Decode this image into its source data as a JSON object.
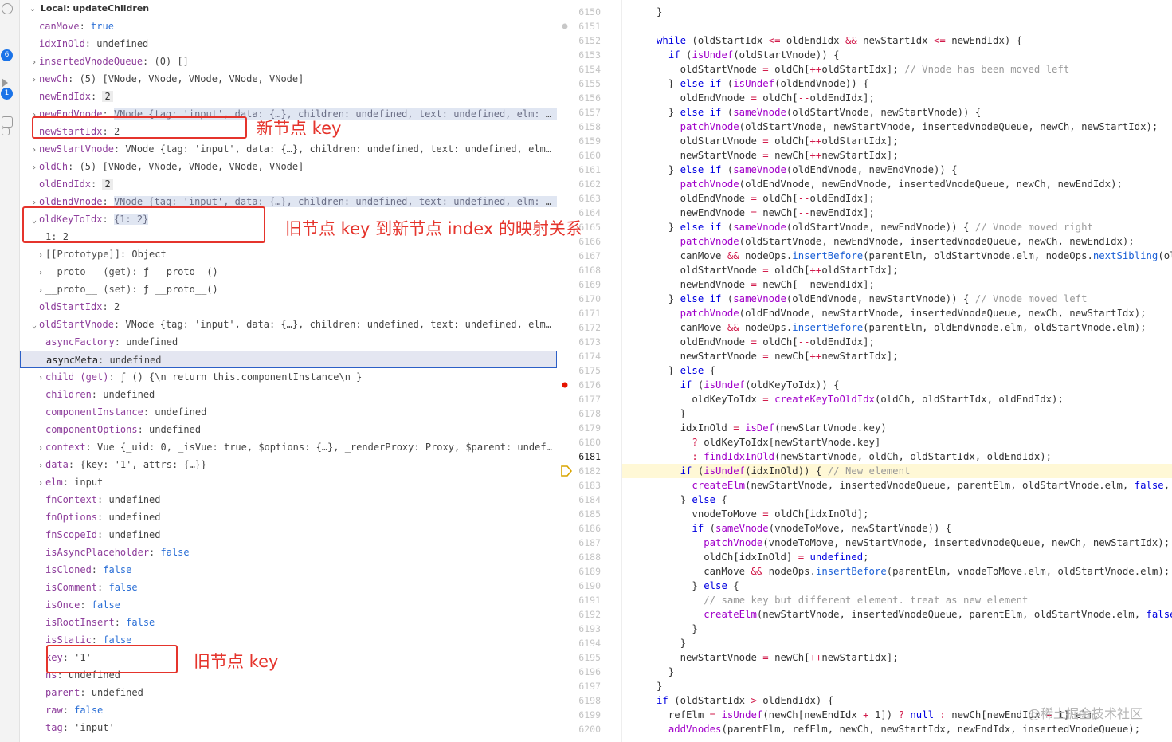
{
  "variables": {
    "scope_header": "Local: updateChildren",
    "rows": [
      {
        "indent": 0,
        "chev": "",
        "key": "canMove",
        "val": "true",
        "vt": "kw"
      },
      {
        "indent": 0,
        "chev": "",
        "key": "idxInOld",
        "val": "undefined",
        "vt": ""
      },
      {
        "indent": 0,
        "chev": "›",
        "key": "insertedVnodeQueue",
        "val": "(0) []",
        "vt": ""
      },
      {
        "indent": 0,
        "chev": "›",
        "key": "newCh",
        "val": "(5) [VNode, VNode, VNode, VNode, VNode]",
        "vt": ""
      },
      {
        "indent": 0,
        "chev": "",
        "key": "newEndIdx",
        "val": "2",
        "vt": "num"
      },
      {
        "indent": 0,
        "chev": "›",
        "key": "newEndVnode",
        "val": "VNode {tag: 'input', data: {…}, children: undefined, text: undefined, elm: undefin…",
        "vt": "hl"
      },
      {
        "indent": 0,
        "chev": "",
        "key": "newStartIdx",
        "val": "2",
        "vt": ""
      },
      {
        "indent": 0,
        "chev": "›",
        "key": "newStartVnode",
        "val": "VNode {tag: 'input', data: {…}, children: undefined, text: undefined, elm: undef…",
        "vt": ""
      },
      {
        "indent": 0,
        "chev": "›",
        "key": "oldCh",
        "val": "(5) [VNode, VNode, VNode, VNode, VNode]",
        "vt": ""
      },
      {
        "indent": 0,
        "chev": "",
        "key": "oldEndIdx",
        "val": "2",
        "vt": "num"
      },
      {
        "indent": 0,
        "chev": "›",
        "key": "oldEndVnode",
        "val": "VNode {tag: 'input', data: {…}, children: undefined, text: undefined, elm: input, …",
        "vt": "hl"
      },
      {
        "indent": 0,
        "chev": "⌄",
        "key": "oldKeyToIdx",
        "val": "{1: 2}",
        "vt": "hl"
      },
      {
        "indent": 1,
        "chev": "",
        "key": "1",
        "val": "2",
        "vt": "",
        "plainkey": true
      },
      {
        "indent": 1,
        "chev": "›",
        "key": "[[Prototype]]",
        "val": "Object",
        "vt": "",
        "plainkey": true
      },
      {
        "indent": 1,
        "chev": "›",
        "key": "__proto__ (get)",
        "val": "ƒ __proto__()",
        "vt": "",
        "plainkey": true
      },
      {
        "indent": 1,
        "chev": "›",
        "key": "__proto__ (set)",
        "val": "ƒ __proto__()",
        "vt": "",
        "plainkey": true
      },
      {
        "indent": 0,
        "chev": "",
        "key": "oldStartIdx",
        "val": "2",
        "vt": ""
      },
      {
        "indent": 0,
        "chev": "⌄",
        "key": "oldStartVnode",
        "val": "VNode {tag: 'input', data: {…}, children: undefined, text: undefined, elm: input…",
        "vt": ""
      },
      {
        "indent": 1,
        "chev": "",
        "key": "asyncFactory",
        "val": "undefined",
        "vt": ""
      },
      {
        "indent": 1,
        "chev": "",
        "key": "asyncMeta",
        "val": "undefined",
        "vt": "",
        "selected": true
      },
      {
        "indent": 1,
        "chev": "›",
        "key": "child (get)",
        "val": "ƒ () {\\n    return this.componentInstance\\n  }",
        "vt": ""
      },
      {
        "indent": 1,
        "chev": "",
        "key": "children",
        "val": "undefined",
        "vt": ""
      },
      {
        "indent": 1,
        "chev": "",
        "key": "componentInstance",
        "val": "undefined",
        "vt": ""
      },
      {
        "indent": 1,
        "chev": "",
        "key": "componentOptions",
        "val": "undefined",
        "vt": ""
      },
      {
        "indent": 1,
        "chev": "›",
        "key": "context",
        "val": "Vue {_uid: 0, _isVue: true, $options: {…}, _renderProxy: Proxy, $parent: undefined, …}",
        "vt": ""
      },
      {
        "indent": 1,
        "chev": "›",
        "key": "data",
        "val": "{key: '1', attrs: {…}}",
        "vt": ""
      },
      {
        "indent": 1,
        "chev": "›",
        "key": "elm",
        "val": "input",
        "vt": ""
      },
      {
        "indent": 1,
        "chev": "",
        "key": "fnContext",
        "val": "undefined",
        "vt": ""
      },
      {
        "indent": 1,
        "chev": "",
        "key": "fnOptions",
        "val": "undefined",
        "vt": ""
      },
      {
        "indent": 1,
        "chev": "",
        "key": "fnScopeId",
        "val": "undefined",
        "vt": ""
      },
      {
        "indent": 1,
        "chev": "",
        "key": "isAsyncPlaceholder",
        "val": "false",
        "vt": "kw"
      },
      {
        "indent": 1,
        "chev": "",
        "key": "isCloned",
        "val": "false",
        "vt": "kw"
      },
      {
        "indent": 1,
        "chev": "",
        "key": "isComment",
        "val": "false",
        "vt": "kw"
      },
      {
        "indent": 1,
        "chev": "",
        "key": "isOnce",
        "val": "false",
        "vt": "kw"
      },
      {
        "indent": 1,
        "chev": "",
        "key": "isRootInsert",
        "val": "false",
        "vt": "kw"
      },
      {
        "indent": 1,
        "chev": "",
        "key": "isStatic",
        "val": "false",
        "vt": "kw"
      },
      {
        "indent": 1,
        "chev": "",
        "key": "key",
        "val": "'1'",
        "vt": ""
      },
      {
        "indent": 1,
        "chev": "",
        "key": "ns",
        "val": "undefined",
        "vt": ""
      },
      {
        "indent": 1,
        "chev": "",
        "key": "parent",
        "val": "undefined",
        "vt": ""
      },
      {
        "indent": 1,
        "chev": "",
        "key": "raw",
        "val": "false",
        "vt": "kw"
      },
      {
        "indent": 1,
        "chev": "",
        "key": "tag",
        "val": "'input'",
        "vt": ""
      }
    ]
  },
  "activity_badges": [
    "6",
    "1"
  ],
  "annotations": [
    {
      "text": "新节点 key"
    },
    {
      "text": "旧节点 key 到新节点 index 的映射关系"
    },
    {
      "text": "旧节点 key"
    }
  ],
  "editor": {
    "current_line": "6181",
    "lines": [
      {
        "n": "6150",
        "html": "<span>}</span>"
      },
      {
        "n": "6151",
        "html": ""
      },
      {
        "n": "6152",
        "html": "<span class=\"t-kw\">while</span> (oldStartIdx <span class=\"t-op\">&lt;=</span> oldEndIdx <span class=\"t-op\">&amp;&amp;</span> newStartIdx <span class=\"t-op\">&lt;=</span> newEndIdx) {"
      },
      {
        "n": "6153",
        "html": "  <span class=\"t-kw\">if</span> (<span class=\"t-fn\">isUndef</span>(oldStartVnode)) {"
      },
      {
        "n": "6154",
        "html": "    oldStartVnode <span class=\"t-op\">=</span> oldCh[<span class=\"t-op\">++</span>oldStartIdx]; <span class=\"t-cm\">// Vnode has been moved left</span>"
      },
      {
        "n": "6155",
        "html": "  } <span class=\"t-kw\">else if</span> (<span class=\"t-fn\">isUndef</span>(oldEndVnode)) {"
      },
      {
        "n": "6156",
        "html": "    oldEndVnode <span class=\"t-op\">=</span> oldCh[<span class=\"t-op\">--</span>oldEndIdx];"
      },
      {
        "n": "6157",
        "html": "  } <span class=\"t-kw\">else if</span> (<span class=\"t-fn\">sameVnode</span>(oldStartVnode, newStartVnode)) {"
      },
      {
        "n": "6158",
        "html": "    <span class=\"t-fn\">patchVnode</span>(oldStartVnode, newStartVnode, insertedVnodeQueue, newCh, newStartIdx);"
      },
      {
        "n": "6159",
        "html": "    oldStartVnode <span class=\"t-op\">=</span> oldCh[<span class=\"t-op\">++</span>oldStartIdx];"
      },
      {
        "n": "6160",
        "html": "    newStartVnode <span class=\"t-op\">=</span> newCh[<span class=\"t-op\">++</span>newStartIdx];"
      },
      {
        "n": "6161",
        "html": "  } <span class=\"t-kw\">else if</span> (<span class=\"t-fn\">sameVnode</span>(oldEndVnode, newEndVnode)) {"
      },
      {
        "n": "6162",
        "html": "    <span class=\"t-fn\">patchVnode</span>(oldEndVnode, newEndVnode, insertedVnodeQueue, newCh, newEndIdx);"
      },
      {
        "n": "6163",
        "html": "    oldEndVnode <span class=\"t-op\">=</span> oldCh[<span class=\"t-op\">--</span>oldEndIdx];"
      },
      {
        "n": "6164",
        "html": "    newEndVnode <span class=\"t-op\">=</span> newCh[<span class=\"t-op\">--</span>newEndIdx];"
      },
      {
        "n": "6165",
        "html": "  } <span class=\"t-kw\">else if</span> (<span class=\"t-fn\">sameVnode</span>(oldStartVnode, newEndVnode)) { <span class=\"t-cm\">// Vnode moved right</span>"
      },
      {
        "n": "6166",
        "html": "    <span class=\"t-fn\">patchVnode</span>(oldStartVnode, newEndVnode, insertedVnodeQueue, newCh, newEndIdx);"
      },
      {
        "n": "6167",
        "html": "    canMove <span class=\"t-op\">&amp;&amp;</span> nodeOps.<span class=\"t-prop\">insertBefore</span>(parentElm, oldStartVnode.elm, nodeOps.<span class=\"t-prop\">nextSibling</span>(oldE"
      },
      {
        "n": "6168",
        "html": "    oldStartVnode <span class=\"t-op\">=</span> oldCh[<span class=\"t-op\">++</span>oldStartIdx];"
      },
      {
        "n": "6169",
        "html": "    newEndVnode <span class=\"t-op\">=</span> newCh[<span class=\"t-op\">--</span>newEndIdx];"
      },
      {
        "n": "6170",
        "html": "  } <span class=\"t-kw\">else if</span> (<span class=\"t-fn\">sameVnode</span>(oldEndVnode, newStartVnode)) { <span class=\"t-cm\">// Vnode moved left</span>"
      },
      {
        "n": "6171",
        "html": "    <span class=\"t-fn\">patchVnode</span>(oldEndVnode, newStartVnode, insertedVnodeQueue, newCh, newStartIdx);"
      },
      {
        "n": "6172",
        "html": "    canMove <span class=\"t-op\">&amp;&amp;</span> nodeOps.<span class=\"t-prop\">insertBefore</span>(parentElm, oldEndVnode.elm, oldStartVnode.elm);"
      },
      {
        "n": "6173",
        "html": "    oldEndVnode <span class=\"t-op\">=</span> oldCh[<span class=\"t-op\">--</span>oldEndIdx];"
      },
      {
        "n": "6174",
        "html": "    newStartVnode <span class=\"t-op\">=</span> newCh[<span class=\"t-op\">++</span>newStartIdx];"
      },
      {
        "n": "6175",
        "html": "  } <span class=\"t-kw\">else</span> {"
      },
      {
        "n": "6176",
        "html": "    <span class=\"t-kw\">if</span> (<span class=\"t-fn\">isUndef</span>(oldKeyToIdx)) {"
      },
      {
        "n": "6177",
        "html": "      oldKeyToIdx <span class=\"t-op\">=</span> <span class=\"t-fn\">createKeyToOldIdx</span>(oldCh, oldStartIdx, oldEndIdx);"
      },
      {
        "n": "6178",
        "html": "    }"
      },
      {
        "n": "6179",
        "html": "    idxInOld <span class=\"t-op\">=</span> <span class=\"t-fn\">isDef</span>(newStartVnode.key)"
      },
      {
        "n": "6180",
        "html": "      <span class=\"t-op\">?</span> oldKeyToIdx[newStartVnode.key]"
      },
      {
        "n": "6181",
        "html": "      <span class=\"t-op\">:</span> <span class=\"t-fn\">findIdxInOld</span>(newStartVnode, oldCh, oldStartIdx, oldEndIdx);"
      },
      {
        "n": "6182",
        "html": "    <span class=\"t-kw\">if</span> (<span class=\"t-fn\">isUndef</span>(idxInOld)) { <span class=\"t-cm\">// New element</span>"
      },
      {
        "n": "6183",
        "html": "      <span class=\"t-fn\">createElm</span>(newStartVnode, insertedVnodeQueue, parentElm, oldStartVnode.elm, <span class=\"t-lit\">false</span>, ne"
      },
      {
        "n": "6184",
        "html": "    } <span class=\"t-kw\">else</span> {"
      },
      {
        "n": "6185",
        "html": "      vnodeToMove <span class=\"t-op\">=</span> oldCh[idxInOld];"
      },
      {
        "n": "6186",
        "html": "      <span class=\"t-kw\">if</span> (<span class=\"t-fn\">sameVnode</span>(vnodeToMove, newStartVnode)) {"
      },
      {
        "n": "6187",
        "html": "        <span class=\"t-fn\">patchVnode</span>(vnodeToMove, newStartVnode, insertedVnodeQueue, newCh, newStartIdx);"
      },
      {
        "n": "6188",
        "html": "        oldCh[idxInOld] <span class=\"t-op\">=</span> <span class=\"t-lit\">undefined</span>;"
      },
      {
        "n": "6189",
        "html": "        canMove <span class=\"t-op\">&amp;&amp;</span> nodeOps.<span class=\"t-prop\">insertBefore</span>(parentElm, vnodeToMove.elm, oldStartVnode.elm);"
      },
      {
        "n": "6190",
        "html": "      } <span class=\"t-kw\">else</span> {"
      },
      {
        "n": "6191",
        "html": "        <span class=\"t-cm\">// same key but different element. treat as new element</span>"
      },
      {
        "n": "6192",
        "html": "        <span class=\"t-fn\">createElm</span>(newStartVnode, insertedVnodeQueue, parentElm, oldStartVnode.elm, <span class=\"t-lit\">false</span>,"
      },
      {
        "n": "6193",
        "html": "      }"
      },
      {
        "n": "6194",
        "html": "    }"
      },
      {
        "n": "6195",
        "html": "    newStartVnode <span class=\"t-op\">=</span> newCh[<span class=\"t-op\">++</span>newStartIdx];"
      },
      {
        "n": "6196",
        "html": "  }"
      },
      {
        "n": "6197",
        "html": "}"
      },
      {
        "n": "6198",
        "html": "<span class=\"t-kw\">if</span> (oldStartIdx <span class=\"t-op\">&gt;</span> oldEndIdx) {"
      },
      {
        "n": "6199",
        "html": "  refElm <span class=\"t-op\">=</span> <span class=\"t-fn\">isUndef</span>(newCh[newEndIdx <span class=\"t-op\">+</span> 1]) <span class=\"t-op\">?</span> <span class=\"t-lit\">null</span> <span class=\"t-op\">:</span> newCh[newEndIdx <span class=\"t-op\">+</span> 1].elm;"
      },
      {
        "n": "6200",
        "html": "  <span class=\"t-fn\">addVnodes</span>(parentElm, refElm, newCh, newStartIdx, newEndIdx, insertedVnodeQueue);"
      }
    ]
  },
  "watermark": "@稀土掘金技术社区"
}
